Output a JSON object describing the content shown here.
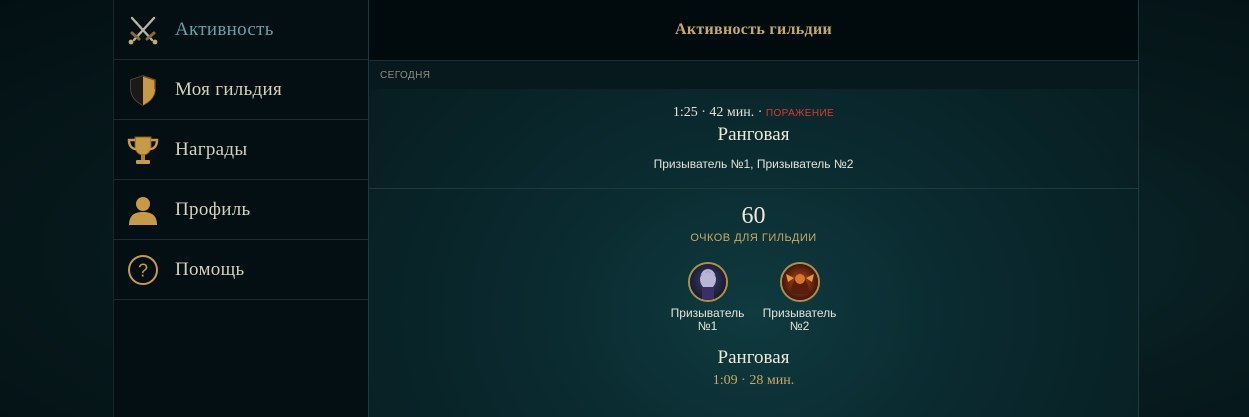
{
  "sidebar": {
    "items": [
      {
        "label": "Активность",
        "icon": "crossed-swords-icon",
        "active": true
      },
      {
        "label": "Моя гильдия",
        "icon": "shield-icon",
        "active": false
      },
      {
        "label": "Награды",
        "icon": "trophy-icon",
        "active": false
      },
      {
        "label": "Профиль",
        "icon": "user-icon",
        "active": false
      },
      {
        "label": "Помощь",
        "icon": "help-icon",
        "active": false
      }
    ]
  },
  "main": {
    "title": "Активность гильдии",
    "day_label": "СЕГОДНЯ",
    "match1": {
      "meta": "1:25 · 42 мин. ·",
      "result": "ПОРАЖЕНИЕ",
      "mode": "Ранговая",
      "players": "Призыватель №1, Призыватель №2"
    },
    "match2": {
      "points": "60",
      "points_label": "ОЧКОВ ДЛЯ ГИЛЬДИИ",
      "participants": [
        {
          "name_line1": "Призыватель",
          "name_line2": "№1"
        },
        {
          "name_line1": "Призыватель",
          "name_line2": "№2"
        }
      ],
      "mode": "Ранговая",
      "meta": "1:09 · 28 мин."
    }
  },
  "colors": {
    "accent_gold": "#c8a961",
    "active_teal": "#5fa3a6",
    "loss_red": "#d93a2e",
    "avatar_border": "#b08f4c"
  }
}
